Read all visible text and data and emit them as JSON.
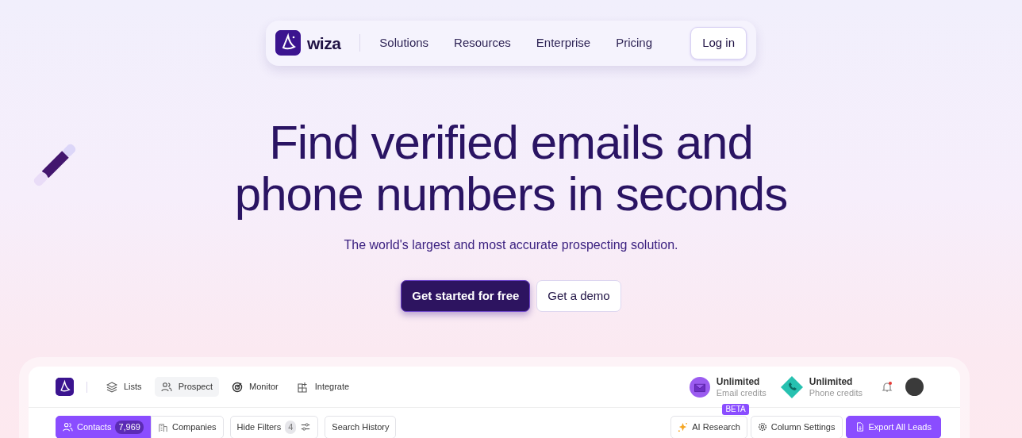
{
  "navbar": {
    "brand": "wiza",
    "links": [
      "Solutions",
      "Resources",
      "Enterprise",
      "Pricing"
    ],
    "login": "Log in"
  },
  "hero": {
    "title": "Find verified emails and phone numbers in seconds",
    "subtitle": "The world's largest and most accurate prospecting solution.",
    "buttons": [
      {
        "label": "Get started for free",
        "kind": "primary"
      },
      {
        "label": "Get a demo",
        "kind": "secondary"
      }
    ]
  },
  "app": {
    "nav": [
      {
        "label": "Lists",
        "kind": "layers",
        "selected": false
      },
      {
        "label": "Prospect",
        "kind": "people",
        "selected": true
      },
      {
        "label": "Monitor",
        "kind": "target",
        "selected": false
      },
      {
        "label": "Integrate",
        "kind": "grid",
        "selected": false
      }
    ],
    "credits": [
      {
        "value": "Unlimited",
        "label": "Email credits",
        "kind": "email"
      },
      {
        "value": "Unlimited",
        "label": "Phone credits",
        "kind": "phone"
      }
    ],
    "notification": true,
    "tabs": [
      {
        "label": "Contacts",
        "count": "7,969",
        "selected": true
      },
      {
        "label": "Companies",
        "selected": false
      }
    ],
    "filters": {
      "label": "Hide Filters",
      "count": "4"
    },
    "history": "Search History",
    "ai": {
      "label": "AI Research",
      "badge": "BETA"
    },
    "columns": "Column Settings",
    "export": "Export All Leads"
  }
}
